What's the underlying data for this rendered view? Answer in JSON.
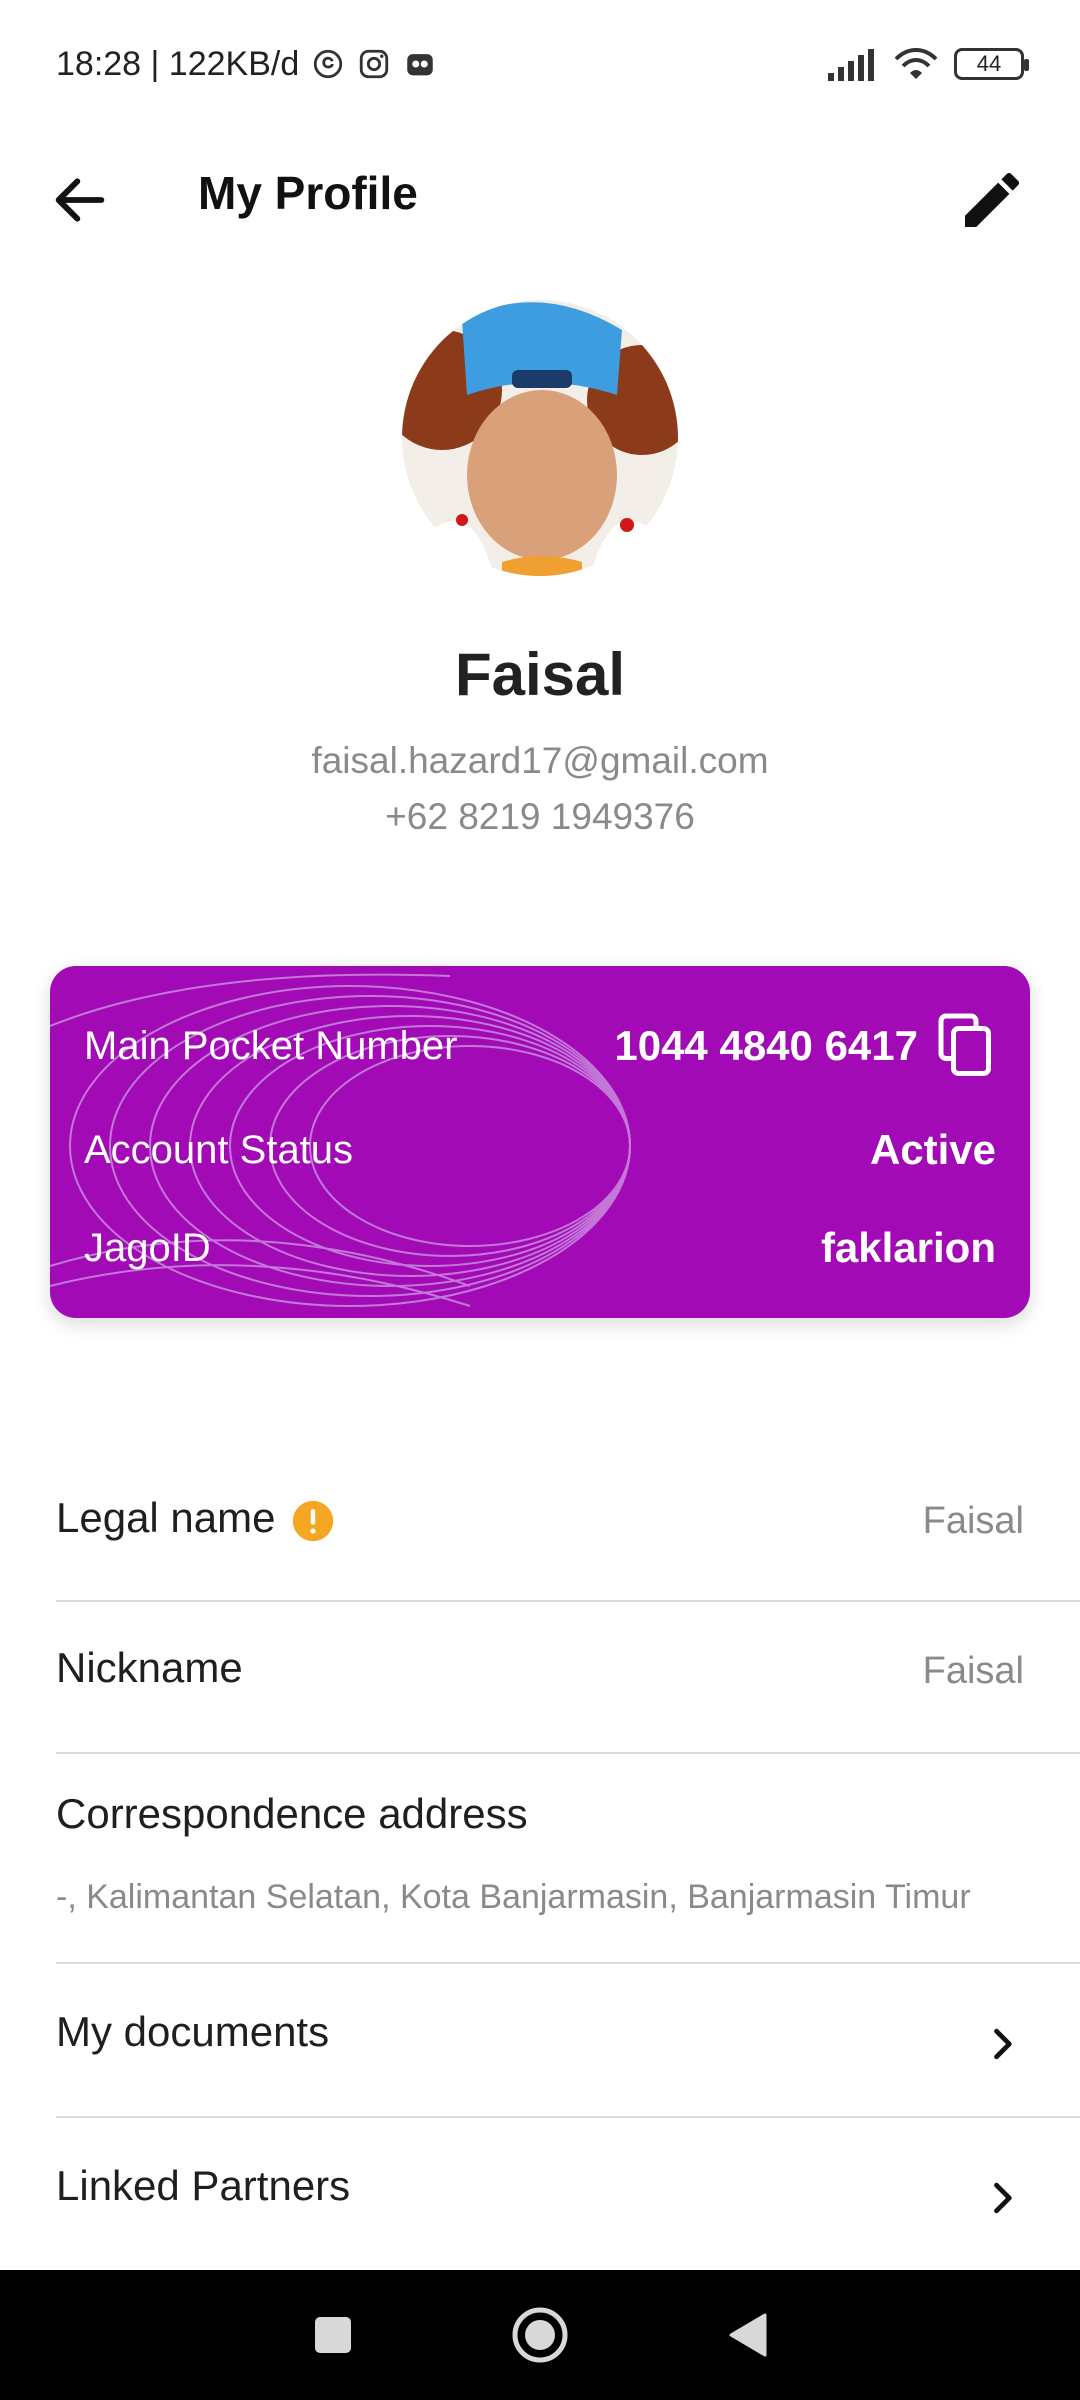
{
  "status_bar": {
    "time_net": "18:28 | 122KB/d",
    "battery": "44"
  },
  "app_bar": {
    "title": "My Profile"
  },
  "profile": {
    "name": "Faisal",
    "email": "faisal.hazard17@gmail.com",
    "phone": "+62 8219 1949376"
  },
  "account_card": {
    "color": "#a10ab4",
    "rows": [
      {
        "label": "Main Pocket Number",
        "value": "1044 4840 6417"
      },
      {
        "label": "Account Status",
        "value": "Active"
      },
      {
        "label": "JagoID",
        "value": "faklarion"
      }
    ]
  },
  "details": {
    "legal_name": {
      "label": "Legal name",
      "value": "Faisal"
    },
    "nickname": {
      "label": "Nickname",
      "value": "Faisal"
    },
    "address": {
      "label": "Correspondence address",
      "value": "-, Kalimantan Selatan, Kota Banjarmasin, Banjarmasin Timur"
    },
    "documents": {
      "label": "My documents"
    },
    "partners": {
      "label": "Linked Partners"
    }
  },
  "icons": {
    "back": "arrow-left-icon",
    "edit": "pencil-icon",
    "copy": "copy-icon",
    "warning": "warning-icon",
    "chevron": "chevron-right-icon"
  },
  "colors": {
    "accent": "#a10ab4",
    "warning": "#f5a623"
  }
}
